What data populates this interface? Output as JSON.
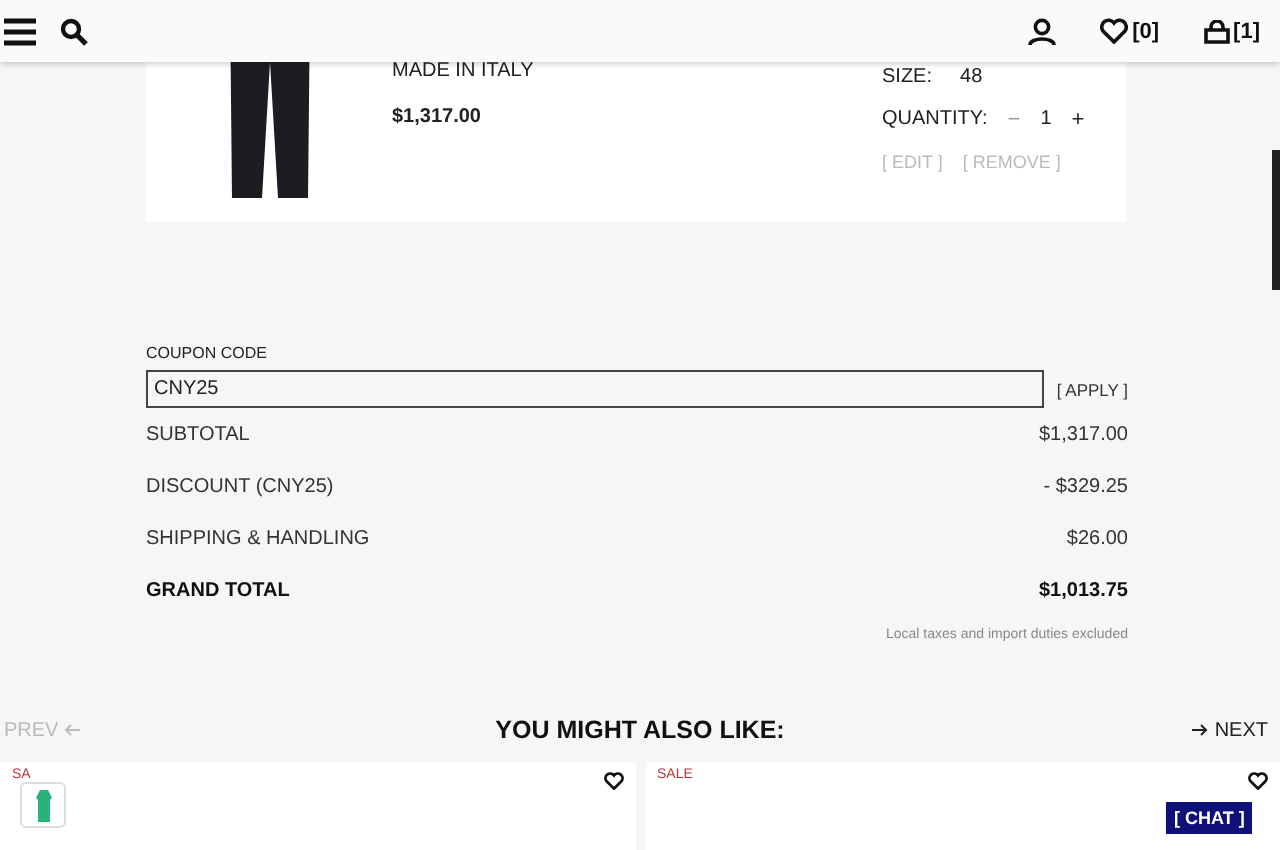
{
  "header": {
    "wishlist_count": "[0]",
    "bag_count": "[1]"
  },
  "cart_item": {
    "origin": "MADE IN ITALY",
    "price": "$1,317.00",
    "size_label": "SIZE:",
    "size_value": "48",
    "quantity_label": "QUANTITY:",
    "decrease": "−",
    "quantity": "1",
    "increase": "+",
    "edit": "[ EDIT ]",
    "remove": "[ REMOVE ]"
  },
  "coupon": {
    "label": "COUPON CODE",
    "value": "CNY25",
    "apply": "[ APPLY ]"
  },
  "totals": [
    {
      "label": "SUBTOTAL",
      "value": "$1,317.00",
      "kind": "line"
    },
    {
      "label": "DISCOUNT (CNY25)",
      "value": "- $329.25",
      "kind": "line"
    },
    {
      "label": "SHIPPING & HANDLING",
      "value": "$26.00",
      "kind": "line"
    },
    {
      "label": "GRAND TOTAL",
      "value": "$1,013.75",
      "kind": "total"
    }
  ],
  "tax_note": "Local taxes and import duties excluded",
  "recommendations": {
    "prev": "PREV",
    "title": "YOU MIGHT ALSO LIKE:",
    "next": "NEXT",
    "products": [
      {
        "tag": "SA"
      },
      {
        "tag": "SALE"
      }
    ]
  },
  "chat": "[ CHAT ]"
}
